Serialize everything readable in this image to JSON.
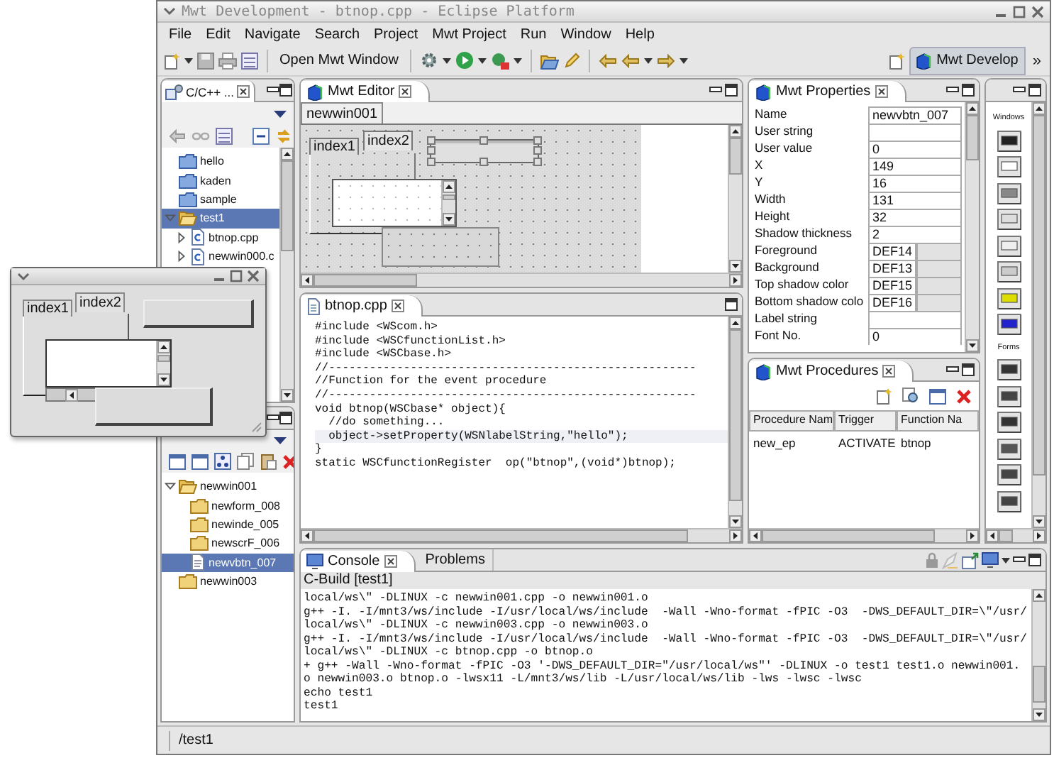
{
  "window": {
    "title": "Mwt Development - btnop.cpp - Eclipse Platform"
  },
  "menu": [
    "File",
    "Edit",
    "Navigate",
    "Search",
    "Project",
    "Mwt Project",
    "Run",
    "Window",
    "Help"
  ],
  "toolbar": {
    "open_button": "Open Mwt Window",
    "perspective": "Mwt Develop",
    "overflow": "»"
  },
  "navigator": {
    "tab": "C/C++ ...",
    "items": [
      {
        "label": "hello",
        "kind": "project",
        "selected": false
      },
      {
        "label": "kaden",
        "kind": "project",
        "selected": false
      },
      {
        "label": "sample",
        "kind": "project",
        "selected": false
      },
      {
        "label": "test1",
        "kind": "project",
        "selected": true,
        "expanded": true,
        "children": [
          {
            "label": "btnop.cpp",
            "kind": "source",
            "selected": false,
            "expanded": false
          },
          {
            "label": "newwin000.c",
            "kind": "source",
            "selected": false,
            "expanded": false
          }
        ]
      }
    ]
  },
  "outline": {
    "items": [
      {
        "label": "newwin001",
        "kind": "folder",
        "selected": false,
        "expanded": true,
        "children": [
          {
            "label": "newform_008",
            "kind": "folder",
            "selected": false
          },
          {
            "label": "newinde_005",
            "kind": "folder",
            "selected": false
          },
          {
            "label": "newscrF_006",
            "kind": "folder",
            "selected": false
          },
          {
            "label": "newvbtn_007",
            "kind": "widget",
            "selected": true
          }
        ]
      },
      {
        "label": "newwin003",
        "kind": "folder",
        "selected": false
      }
    ]
  },
  "designer": {
    "tab": "Mwt Editor",
    "page_tab": "newwin001",
    "tabs": [
      {
        "label": "index1",
        "selected": false
      },
      {
        "label": "index2",
        "selected": true
      }
    ]
  },
  "code_editor": {
    "tab": "btnop.cpp",
    "lines": [
      {
        "text": "#include <WScom.h>",
        "current": false
      },
      {
        "text": "#include <WSCfunctionList.h>",
        "current": false
      },
      {
        "text": "#include <WSCbase.h>",
        "current": false
      },
      {
        "text": "//------------------------------------------------------",
        "current": false
      },
      {
        "text": "//Function for the event procedure",
        "current": false
      },
      {
        "text": "//------------------------------------------------------",
        "current": false
      },
      {
        "text": "void btnop(WSCbase* object){",
        "current": false
      },
      {
        "text": "  //do something...",
        "current": false
      },
      {
        "text": "  object->setProperty(WSNlabelString,\"hello\");",
        "current": true
      },
      {
        "text": "}",
        "current": false
      },
      {
        "text": "static WSCfunctionRegister  op(\"btnop\",(void*)btnop);",
        "current": false
      }
    ]
  },
  "properties": {
    "tab": "Mwt Properties",
    "rows": [
      {
        "name": "Name",
        "value": "newvbtn_007",
        "kind": "text"
      },
      {
        "name": "User string",
        "kind": "text"
      },
      {
        "name": "User value",
        "value": "0",
        "kind": "text"
      },
      {
        "name": "X",
        "value": "149",
        "kind": "text"
      },
      {
        "name": "Y",
        "value": "16",
        "kind": "text"
      },
      {
        "name": "Width",
        "value": "131",
        "kind": "text"
      },
      {
        "name": "Height",
        "value": "32",
        "kind": "text"
      },
      {
        "name": "Shadow thickness",
        "value": "2",
        "kind": "text"
      },
      {
        "name": "Foreground",
        "value": "DEF14",
        "kind": "color"
      },
      {
        "name": "Background",
        "value": "DEF13",
        "kind": "color"
      },
      {
        "name": "Top shadow color",
        "value": "DEF15",
        "kind": "color"
      },
      {
        "name": "Bottom shadow colo",
        "value": "DEF16",
        "kind": "color"
      },
      {
        "name": "Label string",
        "kind": "text"
      },
      {
        "name": "Font No.",
        "value": "0",
        "kind": "text"
      }
    ]
  },
  "procedures": {
    "tab": "Mwt Procedures",
    "columns": [
      "Procedure Nam",
      "Trigger",
      "Function Na"
    ],
    "rows": [
      [
        "new_ep",
        "ACTIVATE",
        "btnop"
      ]
    ]
  },
  "palette": {
    "sections": [
      {
        "label": "Windows"
      },
      {
        "label": "Forms"
      }
    ]
  },
  "console": {
    "tabs": [
      {
        "label": "Console",
        "selected": true
      },
      {
        "label": "Problems",
        "selected": false
      }
    ],
    "title": "C-Build [test1]",
    "lines": [
      "local/ws\\\" -DLINUX -c newwin001.cpp -o newwin001.o",
      "g++ -I. -I/mnt3/ws/include -I/usr/local/ws/include  -Wall -Wno-format -fPIC -O3  -DWS_DEFAULT_DIR=\\\"/usr/",
      "local/ws\\\" -DLINUX -c newwin003.cpp -o newwin003.o",
      "g++ -I. -I/mnt3/ws/include -I/usr/local/ws/include  -Wall -Wno-format -fPIC -O3  -DWS_DEFAULT_DIR=\\\"/usr/",
      "local/ws\\\" -DLINUX -c btnop.cpp -o btnop.o",
      "+ g++ -Wall -Wno-format -fPIC -O3 '-DWS_DEFAULT_DIR=\"/usr/local/ws\"' -DLINUX -o test1 test1.o newwin001.",
      "o newwin003.o btnop.o -lwsx11 -L/mnt3/ws/lib -L/usr/local/ws/lib -lws -lwsc -lwsc",
      "echo test1",
      "test1"
    ]
  },
  "status_bar": {
    "path": "/test1"
  },
  "preview_window": {
    "tabs": [
      {
        "label": "index1",
        "selected": false
      },
      {
        "label": "index2",
        "selected": true
      }
    ]
  }
}
